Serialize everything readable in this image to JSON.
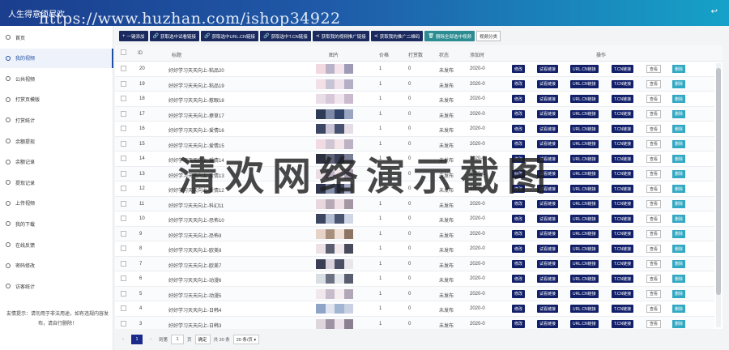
{
  "header": {
    "title": "人生得意须尽欢",
    "watermark_url": "https://www.huzhan.com/ishop34922",
    "back_icon": "↩"
  },
  "sidebar": {
    "items": [
      {
        "label": "首页",
        "icon": "home-icon"
      },
      {
        "label": "我的视频",
        "icon": "video-icon",
        "active": true
      },
      {
        "label": "公共视频",
        "icon": "public-video-icon"
      },
      {
        "label": "打赏页模版",
        "icon": "template-icon"
      },
      {
        "label": "打赏统计",
        "icon": "stats-icon"
      },
      {
        "label": "余额提现",
        "icon": "withdraw-icon"
      },
      {
        "label": "余额记录",
        "icon": "balance-icon"
      },
      {
        "label": "提现记录",
        "icon": "record-icon"
      },
      {
        "label": "上传视频",
        "icon": "upload-icon"
      },
      {
        "label": "我的下载",
        "icon": "download-icon"
      },
      {
        "label": "在线反馈",
        "icon": "feedback-icon"
      },
      {
        "label": "密码修改",
        "icon": "password-icon"
      },
      {
        "label": "访客统计",
        "icon": "visitor-icon"
      }
    ],
    "tip": "友情提示：请勿用于非法用途，如有违规内容发布，请自行删除！"
  },
  "toolbar": {
    "buttons": [
      {
        "label": "一键添加",
        "icon": "+"
      },
      {
        "label": "获取选中试看链接",
        "icon": "🔗"
      },
      {
        "label": "获取选中URL.CN链接",
        "icon": "🔗"
      },
      {
        "label": "获取选中T.CN链接",
        "icon": "🔗"
      },
      {
        "label": "获取我的视频推广链接",
        "icon": "⋖"
      },
      {
        "label": "获取我的推广二维码",
        "icon": "⋖"
      },
      {
        "label": "删除全部选中视频",
        "icon": "🗑"
      }
    ],
    "category_select": "视频分类"
  },
  "table": {
    "columns": [
      "ID",
      "标题",
      "图片",
      "价格",
      "打赏数",
      "状态",
      "添加时",
      "操作"
    ],
    "action_labels": {
      "edit": "修改",
      "trial": "试看链接",
      "urlcn": "URL.CN链接",
      "tcn": "T.CN链接",
      "view": "查看",
      "delete": "删除"
    },
    "rows": [
      {
        "id": "20",
        "title": "好好学习天天向上-粘品20",
        "price": "1",
        "tips": "0",
        "status": "未发布",
        "date": "2020-0",
        "palette": [
          "#f2d9e0",
          "#b9b3c8",
          "#f4e3ea",
          "#9e9bb6"
        ]
      },
      {
        "id": "19",
        "title": "好好学习天天向上-粘品19",
        "price": "1",
        "tips": "0",
        "status": "未发布",
        "date": "2020-0",
        "palette": [
          "#f3dfe6",
          "#c9c3d6",
          "#efe2ea",
          "#b4aec6"
        ]
      },
      {
        "id": "18",
        "title": "好好学习天天向上-惹眼18",
        "price": "1",
        "tips": "0",
        "status": "未发布",
        "date": "2020-0",
        "palette": [
          "#e9dde7",
          "#d7c7d9",
          "#f1e6ee",
          "#cbb9ce"
        ]
      },
      {
        "id": "17",
        "title": "好好学习天天向上-撩草17",
        "price": "1",
        "tips": "0",
        "status": "未发布",
        "date": "2020-0",
        "palette": [
          "#2e3b57",
          "#7e8aa7",
          "#34436a",
          "#9aa5c2"
        ]
      },
      {
        "id": "16",
        "title": "好好学习天天向上-爱情16",
        "price": "1",
        "tips": "0",
        "status": "未发布",
        "date": "2020-0",
        "palette": [
          "#3a4662",
          "#c9c3d6",
          "#46526f",
          "#e4dde6"
        ]
      },
      {
        "id": "15",
        "title": "好好学习天天向上-爱情15",
        "price": "1",
        "tips": "0",
        "status": "未发布",
        "date": "2020-0",
        "palette": [
          "#f0dbe3",
          "#d0c5d3",
          "#f3e4ea",
          "#bdb1c4"
        ]
      },
      {
        "id": "14",
        "title": "好好学习天天向上-爱情14",
        "price": "1",
        "tips": "0",
        "status": "未发布",
        "date": "2020-0",
        "palette": [
          "#2b2f3e",
          "#5e6378",
          "#39405a",
          "#7a7f98"
        ]
      },
      {
        "id": "13",
        "title": "好好学习天天向上-爱情13",
        "price": "1",
        "tips": "0",
        "status": "未发布",
        "date": "2020-0",
        "palette": [
          "#eadce3",
          "#bfb5c7",
          "#f2e4ea",
          "#ab9fb5"
        ]
      },
      {
        "id": "12",
        "title": "好好学习天天向上-爱情12",
        "price": "1",
        "tips": "0",
        "status": "未发布",
        "date": "2020-0",
        "palette": [
          "#30374e",
          "#8790a9",
          "#3a425d",
          "#a3aac1"
        ]
      },
      {
        "id": "11",
        "title": "好好学习天天向上-科幻11",
        "price": "1",
        "tips": "0",
        "status": "未发布",
        "date": "2020-0",
        "palette": [
          "#e8d8dd",
          "#b8a9b6",
          "#efe0e5",
          "#a596a4"
        ]
      },
      {
        "id": "10",
        "title": "好好学习天天向上-恐怖10",
        "price": "1",
        "tips": "0",
        "status": "未发布",
        "date": "2020-0",
        "palette": [
          "#3c4661",
          "#b3bdd3",
          "#4a5572",
          "#cfd6e6"
        ]
      },
      {
        "id": "9",
        "title": "好好学习天天向上-恐怖9",
        "price": "1",
        "tips": "0",
        "status": "未发布",
        "date": "2020-0",
        "palette": [
          "#e6d2c6",
          "#a88f7d",
          "#efdfd4",
          "#8d7463"
        ]
      },
      {
        "id": "8",
        "title": "好好学习天天向上-欧美8",
        "price": "1",
        "tips": "0",
        "status": "未发布",
        "date": "2020-0",
        "palette": [
          "#ece2e6",
          "#5b5e6f",
          "#f1e8ec",
          "#474a5b"
        ]
      },
      {
        "id": "7",
        "title": "好好学习天天向上-欧美7",
        "price": "1",
        "tips": "0",
        "status": "未发布",
        "date": "2020-0",
        "palette": [
          "#3b3f55",
          "#d9d2dc",
          "#4a4f66",
          "#ebe5ec"
        ]
      },
      {
        "id": "6",
        "title": "好好学习天天向上-动漫6",
        "price": "1",
        "tips": "0",
        "status": "未发布",
        "date": "2020-0",
        "palette": [
          "#d9dde4",
          "#6d7283",
          "#e6e9ee",
          "#585d6f"
        ]
      },
      {
        "id": "5",
        "title": "好好学习天天向上-动漫5",
        "price": "1",
        "tips": "0",
        "status": "未发布",
        "date": "2020-0",
        "palette": [
          "#f2e7ec",
          "#c7bccb",
          "#f6edf1",
          "#b2a7b8"
        ]
      },
      {
        "id": "4",
        "title": "好好学习天天向上-日韩4",
        "price": "1",
        "tips": "0",
        "status": "未发布",
        "date": "2020-0",
        "palette": [
          "#8fa4c6",
          "#dfe4ee",
          "#a2b5d3",
          "#c8d2e4"
        ]
      },
      {
        "id": "3",
        "title": "好好学习天天向上-日韩3",
        "price": "1",
        "tips": "0",
        "status": "未发布",
        "date": "2020-0",
        "palette": [
          "#dfd5dd",
          "#9d93a3",
          "#ebe3e9",
          "#8a8092"
        ]
      }
    ]
  },
  "pager": {
    "prev": "‹",
    "current": "1",
    "next": "›",
    "goto_label": "到第",
    "goto_value": "1",
    "page_unit": "页",
    "confirm": "确定",
    "total": "共 20 条",
    "page_size": "20 条/页 ▾"
  },
  "watermark_text": "清欢网络演示截图",
  "colors": {
    "nav_dark": "#1b2a5e",
    "action_blue": "#12206a",
    "delete_cyan": "#33a8c3",
    "accent": "#1f4fa0"
  }
}
